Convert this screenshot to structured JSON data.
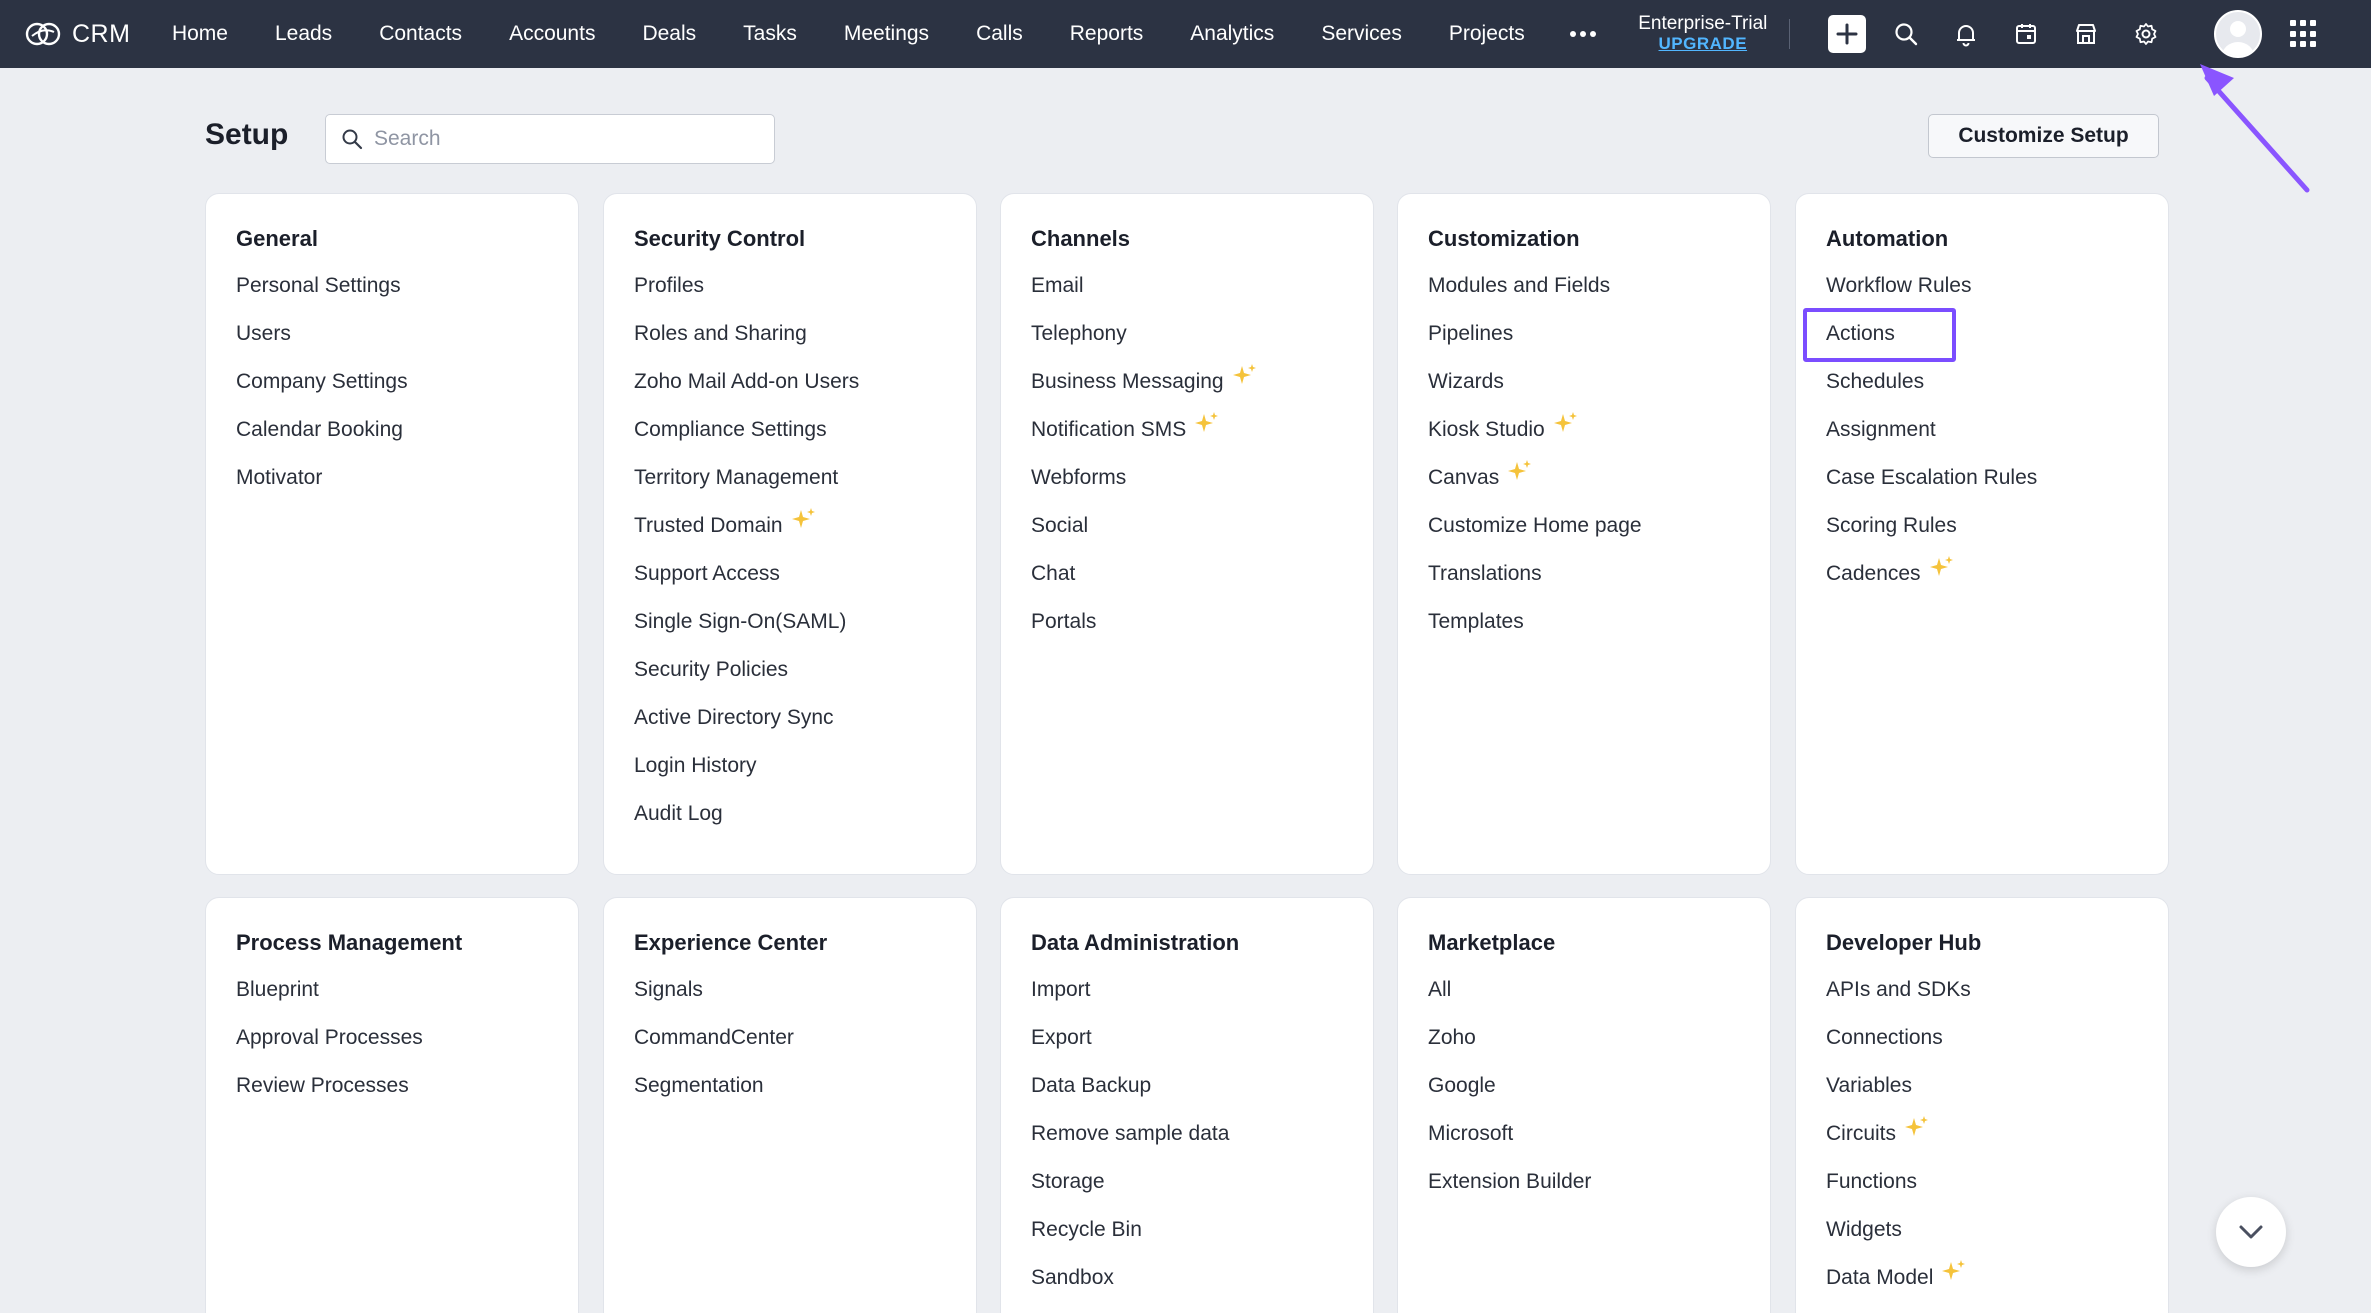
{
  "app": {
    "name": "CRM"
  },
  "nav": {
    "items": [
      "Home",
      "Leads",
      "Contacts",
      "Accounts",
      "Deals",
      "Tasks",
      "Meetings",
      "Calls",
      "Reports",
      "Analytics",
      "Services",
      "Projects"
    ],
    "more_icon": "ellipsis-icon"
  },
  "trial": {
    "label": "Enterprise-Trial",
    "upgrade": "UPGRADE"
  },
  "toolbar_icons": [
    "plus-icon",
    "search-icon",
    "bell-icon",
    "calendar-icon",
    "store-icon",
    "gear-icon",
    "avatar",
    "apps-grid-icon"
  ],
  "header": {
    "title": "Setup",
    "search_placeholder": "Search",
    "customize_label": "Customize Setup"
  },
  "cards": [
    {
      "title": "General",
      "items": [
        {
          "label": "Personal Settings"
        },
        {
          "label": "Users"
        },
        {
          "label": "Company Settings"
        },
        {
          "label": "Calendar Booking"
        },
        {
          "label": "Motivator"
        }
      ]
    },
    {
      "title": "Security Control",
      "items": [
        {
          "label": "Profiles"
        },
        {
          "label": "Roles and Sharing"
        },
        {
          "label": "Zoho Mail Add-on Users"
        },
        {
          "label": "Compliance Settings"
        },
        {
          "label": "Territory Management"
        },
        {
          "label": "Trusted Domain",
          "sparkle": true
        },
        {
          "label": "Support Access"
        },
        {
          "label": "Single Sign-On(SAML)"
        },
        {
          "label": "Security Policies"
        },
        {
          "label": "Active Directory Sync"
        },
        {
          "label": "Login History"
        },
        {
          "label": "Audit Log"
        }
      ]
    },
    {
      "title": "Channels",
      "items": [
        {
          "label": "Email"
        },
        {
          "label": "Telephony"
        },
        {
          "label": "Business Messaging",
          "sparkle": true
        },
        {
          "label": "Notification SMS",
          "sparkle": true
        },
        {
          "label": "Webforms"
        },
        {
          "label": "Social"
        },
        {
          "label": "Chat"
        },
        {
          "label": "Portals"
        }
      ]
    },
    {
      "title": "Customization",
      "items": [
        {
          "label": "Modules and Fields"
        },
        {
          "label": "Pipelines"
        },
        {
          "label": "Wizards"
        },
        {
          "label": "Kiosk Studio",
          "sparkle": true
        },
        {
          "label": "Canvas",
          "sparkle": true
        },
        {
          "label": "Customize Home page"
        },
        {
          "label": "Translations"
        },
        {
          "label": "Templates"
        }
      ]
    },
    {
      "title": "Automation",
      "items": [
        {
          "label": "Workflow Rules"
        },
        {
          "label": "Actions",
          "highlighted": true
        },
        {
          "label": "Schedules"
        },
        {
          "label": "Assignment"
        },
        {
          "label": "Case Escalation Rules"
        },
        {
          "label": "Scoring Rules"
        },
        {
          "label": "Cadences",
          "sparkle": true
        }
      ]
    },
    {
      "title": "Process Management",
      "items": [
        {
          "label": "Blueprint"
        },
        {
          "label": "Approval Processes"
        },
        {
          "label": "Review Processes"
        }
      ]
    },
    {
      "title": "Experience Center",
      "items": [
        {
          "label": "Signals"
        },
        {
          "label": "CommandCenter"
        },
        {
          "label": "Segmentation"
        }
      ]
    },
    {
      "title": "Data Administration",
      "items": [
        {
          "label": "Import"
        },
        {
          "label": "Export"
        },
        {
          "label": "Data Backup"
        },
        {
          "label": "Remove sample data"
        },
        {
          "label": "Storage"
        },
        {
          "label": "Recycle Bin"
        },
        {
          "label": "Sandbox"
        }
      ]
    },
    {
      "title": "Marketplace",
      "items": [
        {
          "label": "All"
        },
        {
          "label": "Zoho"
        },
        {
          "label": "Google"
        },
        {
          "label": "Microsoft"
        },
        {
          "label": "Extension Builder"
        }
      ]
    },
    {
      "title": "Developer Hub",
      "items": [
        {
          "label": "APIs and SDKs"
        },
        {
          "label": "Connections"
        },
        {
          "label": "Variables"
        },
        {
          "label": "Circuits",
          "sparkle": true
        },
        {
          "label": "Functions"
        },
        {
          "label": "Widgets"
        },
        {
          "label": "Data Model",
          "sparkle": true
        }
      ]
    }
  ],
  "colors": {
    "topbar": "#2c3343",
    "background": "#eceef2",
    "highlight": "#7b4dff",
    "sparkle": "#f5c33b",
    "upgrade": "#52b6ff"
  }
}
